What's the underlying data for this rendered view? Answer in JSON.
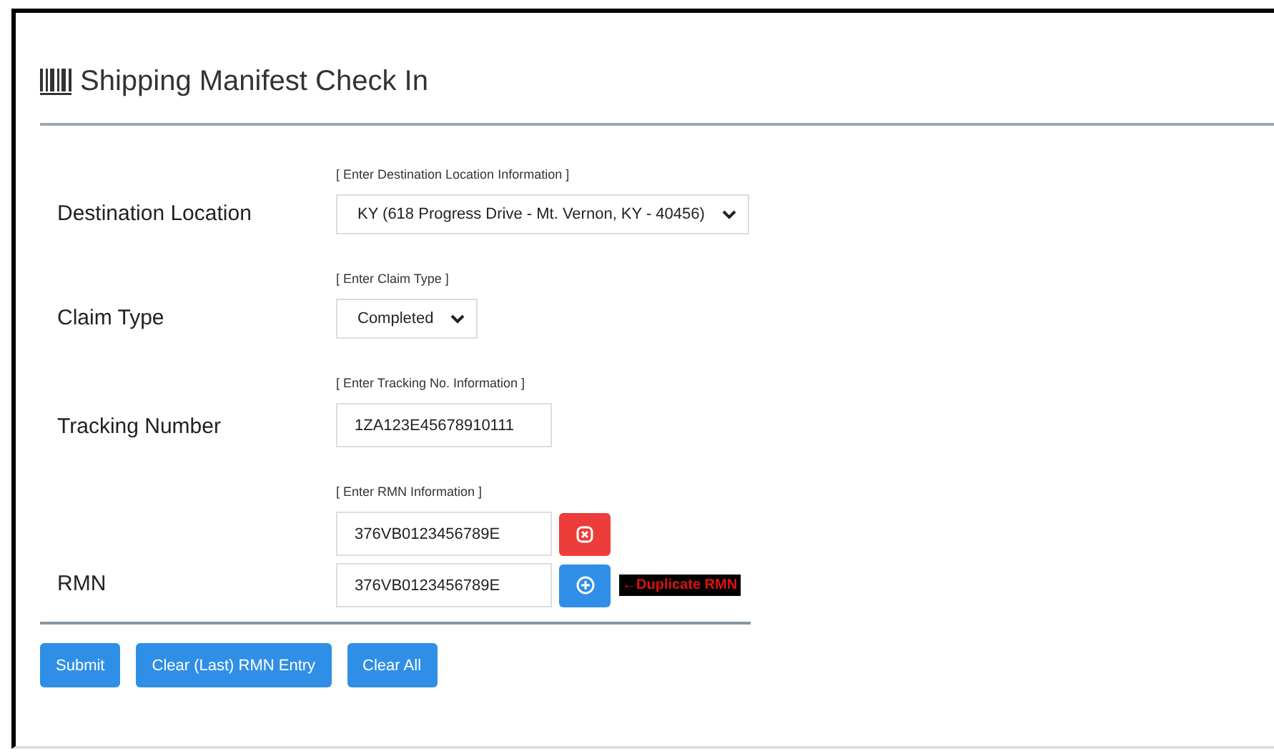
{
  "title": "Shipping Manifest Check In",
  "fields": [
    {
      "label": "Destination Location",
      "hint": "[ Enter Destination Location Information ]",
      "kind": "select",
      "value": "KY (618 Progress Drive - Mt. Vernon, KY - 40456)"
    },
    {
      "label": "Claim Type",
      "hint": "[ Enter Claim Type ]",
      "kind": "select",
      "value": "Completed"
    },
    {
      "label": "Tracking Number",
      "hint": "[ Enter Tracking No. Information ]",
      "kind": "input",
      "value": "1ZA123E45678910111"
    }
  ],
  "rmn": {
    "label": "RMN",
    "hint": "[ Enter RMN Information ]",
    "entries": [
      {
        "value": "376VB0123456789E",
        "kind": "remove"
      },
      {
        "value": "376VB0123456789E",
        "kind": "add",
        "note": "←Duplicate RMN"
      }
    ]
  },
  "buttons": [
    "Submit",
    "Clear (Last) RMN Entry",
    "Clear All"
  ]
}
